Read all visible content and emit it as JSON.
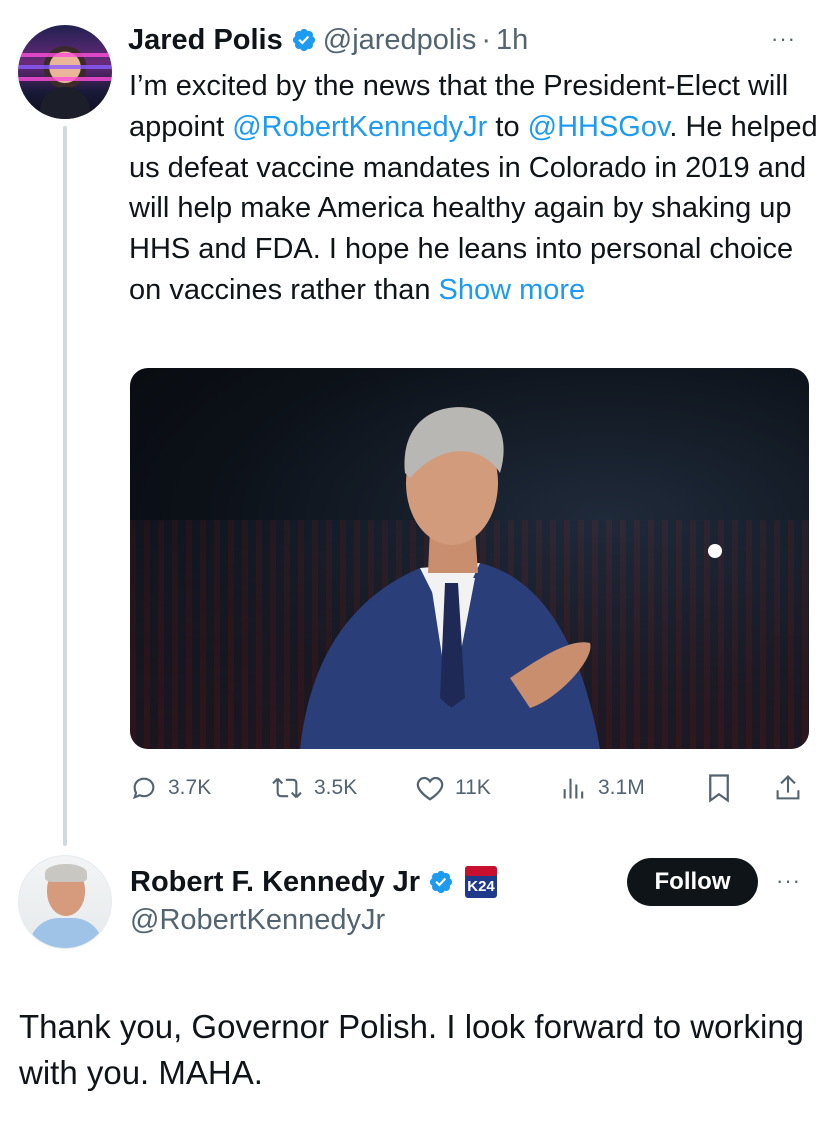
{
  "tweet": {
    "author_name": "Jared Polis",
    "author_handle": "@jaredpolis",
    "separator": "·",
    "time": "1h",
    "more_label": "···",
    "text_segments": [
      {
        "type": "text",
        "value": "I’m excited by the news that the President-Elect will appoint "
      },
      {
        "type": "mention",
        "value": "@RobertKennedyJr"
      },
      {
        "type": "text",
        "value": " to "
      },
      {
        "type": "mention",
        "value": "@HHSGov"
      },
      {
        "type": "text",
        "value": ". He helped us defeat vaccine mandates in Colorado in 2019 and will help make America healthy again by shaking up HHS and FDA. I hope he leans into personal choice on vaccines rather than "
      }
    ],
    "show_more": "Show more",
    "actions": {
      "replies": "3.7K",
      "reposts": "3.5K",
      "likes": "11K",
      "views": "3.1M"
    }
  },
  "reply": {
    "author_name": "Robert F. Kennedy Jr",
    "author_handle": "@RobertKennedyJr",
    "affiliate_badge": "K24",
    "follow_label": "Follow",
    "more_label": "···",
    "text": "Thank you, Governor Polish. I look forward to working with you. MAHA."
  },
  "colors": {
    "link": "#1d9bf0",
    "text": "#0f1419",
    "secondary": "#536471",
    "thread_line": "#cfd9de"
  },
  "icons": [
    "verified-badge-icon",
    "more-options-icon",
    "reply-icon",
    "repost-icon",
    "like-icon",
    "views-icon",
    "bookmark-icon",
    "share-icon",
    "affiliate-badge-icon"
  ]
}
